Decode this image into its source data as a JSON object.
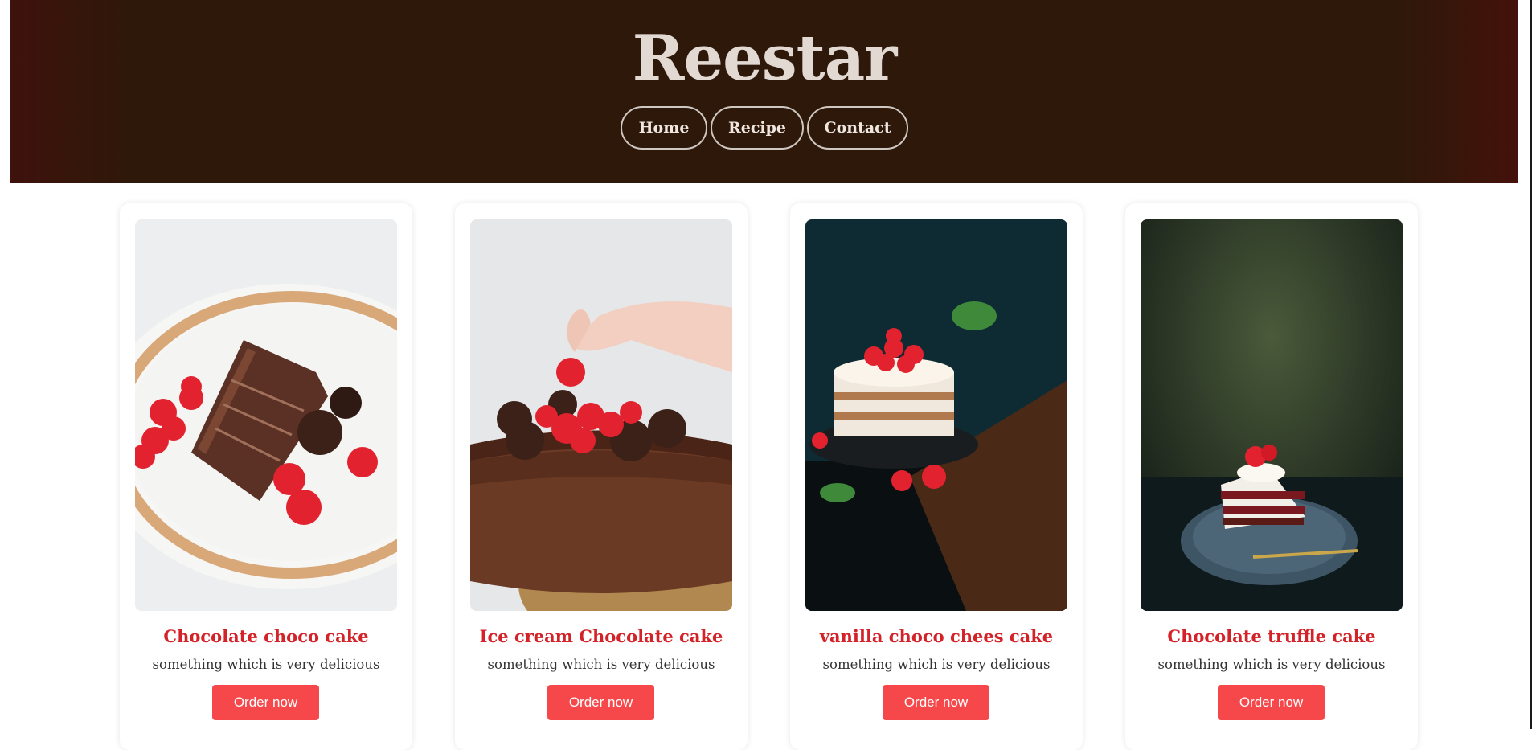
{
  "site": {
    "title": "Reestar"
  },
  "nav": {
    "home": "Home",
    "recipe": "Recipe",
    "contact": "Contact"
  },
  "colors": {
    "header_bg": "#2e180a",
    "accent": "#d32228",
    "button": "#f6484a"
  },
  "cards": [
    {
      "title": "Chocolate choco cake",
      "description": "something which is very delicious",
      "button": "Order now",
      "image": "chocolate-cake-slice-with-raspberries"
    },
    {
      "title": "Ice cream Chocolate cake",
      "description": "something which is very delicious",
      "button": "Order now",
      "image": "chocolate-cake-with-strawberries-and-hand"
    },
    {
      "title": "vanilla choco chees cake",
      "description": "something which is very delicious",
      "button": "Order now",
      "image": "layered-cream-cake-with-strawberries"
    },
    {
      "title": "Chocolate truffle cake",
      "description": "something which is very delicious",
      "button": "Order now",
      "image": "red-velvet-cake-slice-on-plate"
    }
  ]
}
